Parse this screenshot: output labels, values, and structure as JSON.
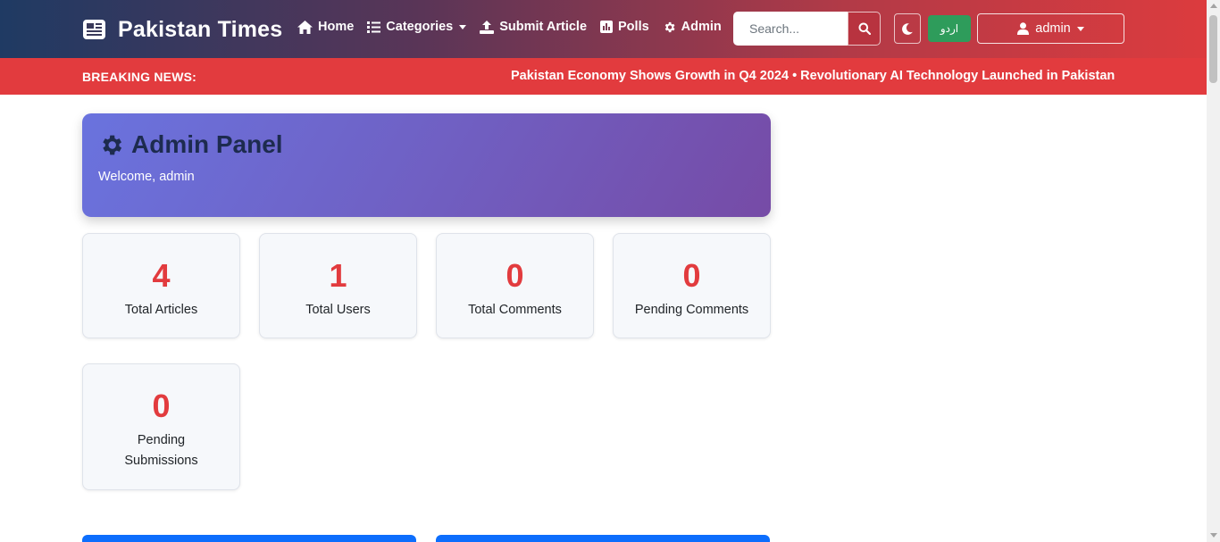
{
  "navbar": {
    "brand": "Pakistan Times",
    "links": [
      {
        "label": "Home",
        "icon": "home-icon"
      },
      {
        "label": "Categories",
        "icon": "list-icon"
      },
      {
        "label": "Submit Article",
        "icon": "upload-icon"
      },
      {
        "label": "Polls",
        "icon": "poll-icon"
      },
      {
        "label": "Admin",
        "icon": "gear-icon"
      }
    ],
    "search_placeholder": "Search...",
    "language_label": "اردو",
    "user_label": "admin"
  },
  "breaking": {
    "label": "BREAKING NEWS:",
    "ticker": "Pakistan Economy Shows Growth in Q4 2024 • Revolutionary AI Technology Launched in Pakistan"
  },
  "admin": {
    "title": "Admin Panel",
    "welcome": "Welcome, admin"
  },
  "stats": [
    {
      "value": "4",
      "label": "Total Articles"
    },
    {
      "value": "1",
      "label": "Total Users"
    },
    {
      "value": "0",
      "label": "Total Comments"
    },
    {
      "value": "0",
      "label": "Pending Comments"
    },
    {
      "value": "0",
      "label": "Pending Submissions"
    }
  ],
  "colors": {
    "accent_red": "#e23b3e",
    "brand_green": "#2e9c5b",
    "primary_blue": "#0d6efd"
  }
}
